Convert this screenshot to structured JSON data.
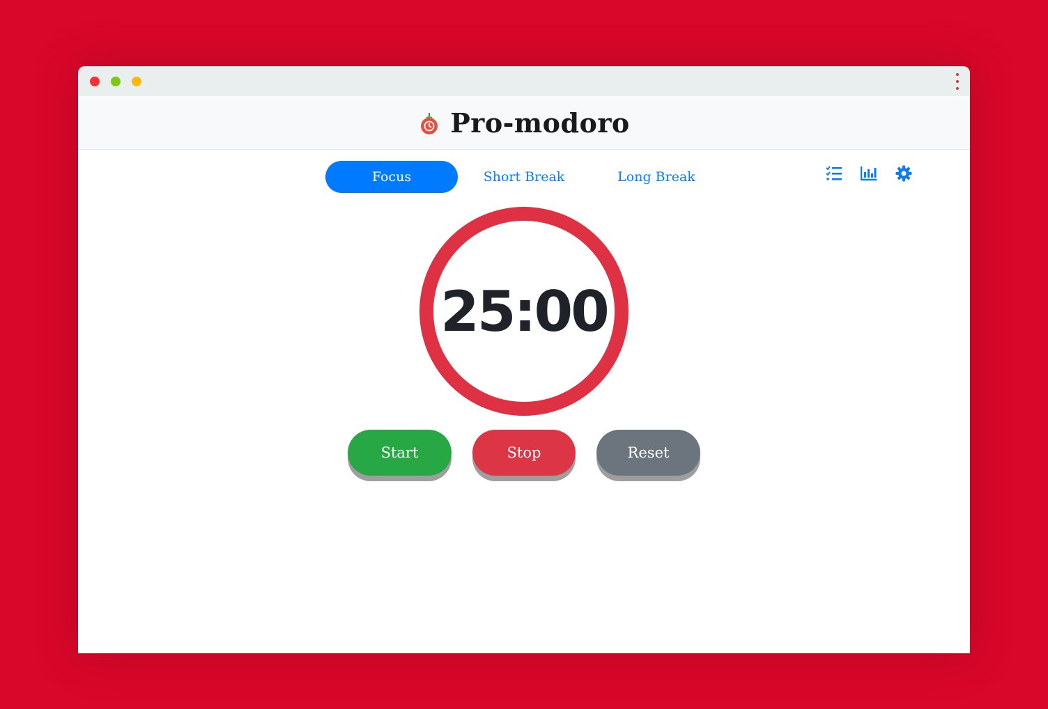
{
  "app": {
    "title": "Pro-modoro"
  },
  "tabs": [
    {
      "label": "Focus",
      "active": true
    },
    {
      "label": "Short Break",
      "active": false
    },
    {
      "label": "Long Break",
      "active": false
    }
  ],
  "toolbar": {
    "icons": [
      "tasks-icon",
      "stats-chart-icon",
      "gear-icon"
    ]
  },
  "timer": {
    "display": "25:00"
  },
  "controls": {
    "start_label": "Start",
    "stop_label": "Stop",
    "reset_label": "Reset"
  },
  "colors": {
    "background": "#d9072a",
    "accent": "#007bff",
    "ring": "#de3143",
    "start": "#28a745",
    "stop": "#dc3545",
    "reset": "#6c757d"
  }
}
